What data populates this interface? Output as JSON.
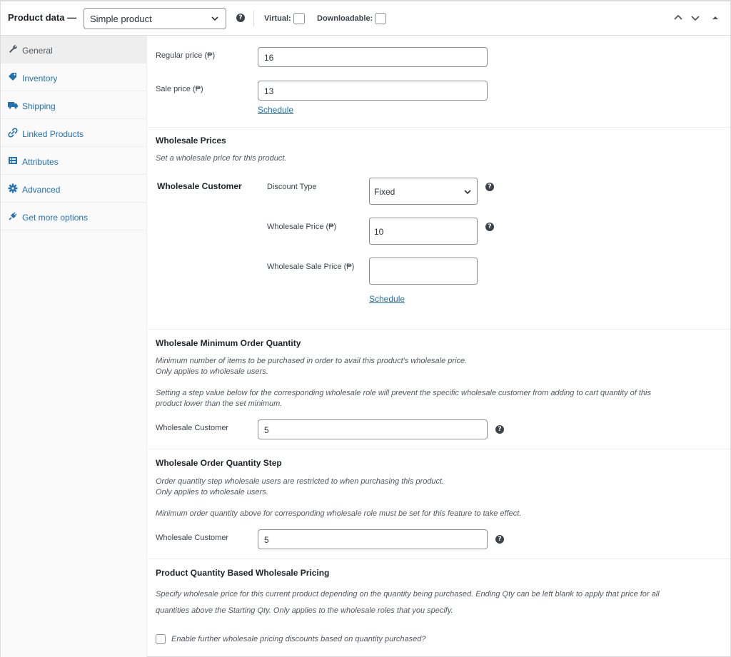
{
  "header": {
    "title": "Product data —",
    "product_type": "Simple product",
    "virtual_label": "Virtual:",
    "downloadable_label": "Downloadable:"
  },
  "sidebar": {
    "items": [
      {
        "label": "General",
        "icon": "wrench-icon",
        "active": true
      },
      {
        "label": "Inventory",
        "icon": "tag-icon"
      },
      {
        "label": "Shipping",
        "icon": "truck-icon"
      },
      {
        "label": "Linked Products",
        "icon": "link-icon"
      },
      {
        "label": "Attributes",
        "icon": "list-icon"
      },
      {
        "label": "Advanced",
        "icon": "gear-icon"
      },
      {
        "label": "Get more options",
        "icon": "plugin-icon"
      }
    ]
  },
  "pricing": {
    "regular_label": "Regular price (₱)",
    "regular_value": "16",
    "sale_label": "Sale price (₱)",
    "sale_value": "13",
    "schedule": "Schedule"
  },
  "wholesale_prices": {
    "heading": "Wholesale Prices",
    "desc": "Set a wholesale price for this product.",
    "role": "Wholesale Customer",
    "discount_type_label": "Discount Type",
    "discount_type_value": "Fixed",
    "price_label": "Wholesale Price (₱)",
    "price_value": "10",
    "sale_price_label": "Wholesale Sale Price (₱)",
    "sale_price_value": "",
    "schedule": "Schedule"
  },
  "min_order": {
    "heading": "Wholesale Minimum Order Quantity",
    "desc1": "Minimum number of items to be purchased in order to avail this product's wholesale price.",
    "desc2": "Only applies to wholesale users.",
    "desc3": "Setting a step value below for the corresponding wholesale role will prevent the specific wholesale customer from adding to cart quantity of this",
    "desc4": "product lower than the set minimum.",
    "field_label": "Wholesale Customer",
    "field_value": "5"
  },
  "qty_step": {
    "heading": "Wholesale Order Quantity Step",
    "desc1": "Order quantity step wholesale users are restricted to when purchasing this product.",
    "desc2": "Only applies to wholesale users.",
    "desc3": "Minimum order quantity above for corresponding wholesale role must be set for this feature to take effect.",
    "field_label": "Wholesale Customer",
    "field_value": "5"
  },
  "qty_pricing": {
    "heading": "Product Quantity Based Wholesale Pricing",
    "desc1": "Specify wholesale price for this current product depending on the quantity being purchased. Ending Qty can be left blank to apply that price for all",
    "desc2": "quantities above the Starting Qty. Only applies to the wholesale roles that you specify.",
    "enable_label": "Enable further wholesale pricing discounts based on quantity purchased?"
  }
}
